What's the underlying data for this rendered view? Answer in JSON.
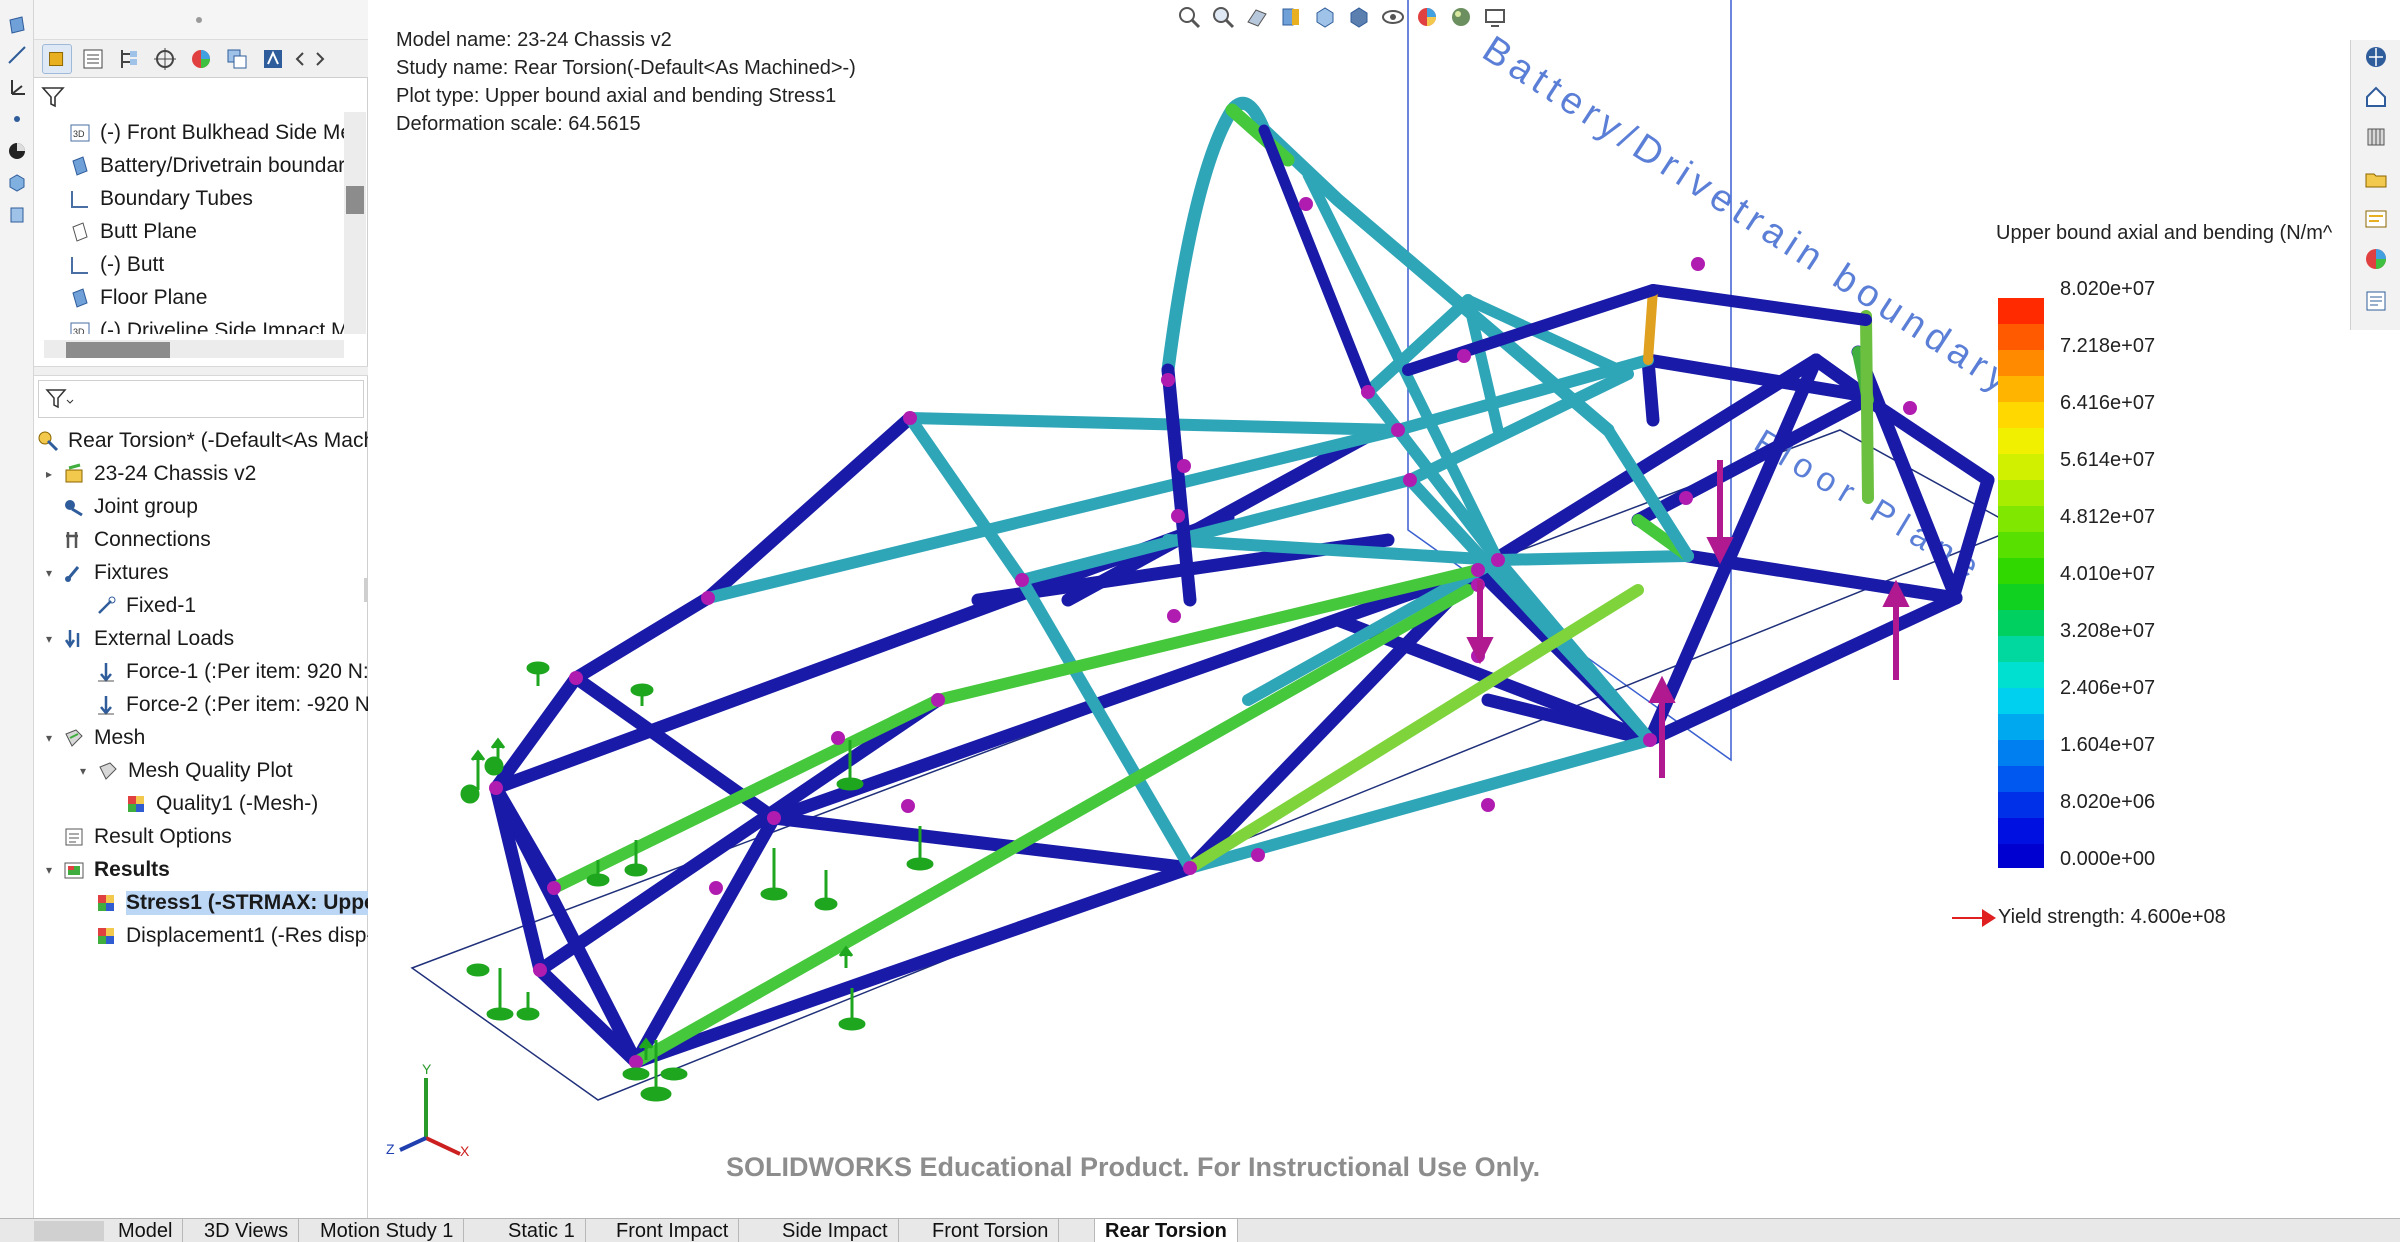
{
  "feature_tree": {
    "items": [
      {
        "label": "(-) Front Bulkhead Side Me",
        "icon": "3d-sketch-icon"
      },
      {
        "label": "Battery/Drivetrain boundar",
        "icon": "plane-icon"
      },
      {
        "label": "Boundary Tubes",
        "icon": "sketch-icon"
      },
      {
        "label": "Butt Plane",
        "icon": "plane-icon"
      },
      {
        "label": "(-) Butt",
        "icon": "sketch-icon"
      },
      {
        "label": "Floor Plane",
        "icon": "plane-icon"
      },
      {
        "label": "(-) Driveline Side Impact M",
        "icon": "3d-sketch-icon"
      }
    ]
  },
  "simulation_tree": {
    "root": "Rear Torsion* (-Default<As Mach",
    "items": [
      {
        "label": "23-24 Chassis v2",
        "icon": "part-icon"
      },
      {
        "label": "Joint group",
        "icon": "joint-group-icon"
      },
      {
        "label": "Connections",
        "icon": "connections-icon"
      },
      {
        "label": "Fixtures",
        "icon": "fixtures-icon"
      },
      {
        "label": "Fixed-1",
        "icon": "fixed-icon"
      },
      {
        "label": "External Loads",
        "icon": "external-loads-icon"
      },
      {
        "label": "Force-1 (:Per item: 920 N:)",
        "icon": "force-icon"
      },
      {
        "label": "Force-2 (:Per item: -920 N:",
        "icon": "force-icon"
      },
      {
        "label": "Mesh",
        "icon": "mesh-icon"
      },
      {
        "label": "Mesh Quality Plot",
        "icon": "mesh-quality-icon"
      },
      {
        "label": "Quality1 (-Mesh-)",
        "icon": "plot-icon"
      },
      {
        "label": "Result Options",
        "icon": "result-options-icon"
      },
      {
        "label": "Results",
        "icon": "results-icon"
      },
      {
        "label": "Stress1 (-STRMAX: Uppe",
        "icon": "plot-icon"
      },
      {
        "label": "Displacement1 (-Res disp-",
        "icon": "plot-icon"
      }
    ]
  },
  "plot_info": {
    "model_name": "Model name: 23-24 Chassis v2",
    "study_name": "Study name: Rear Torsion(-Default<As Machined>-)",
    "plot_type": "Plot type: Upper bound axial and bending Stress1",
    "deformation_scale": "Deformation scale: 64.5615"
  },
  "legend": {
    "title": "Upper bound axial and bending (N/m^",
    "values": [
      "8.020e+07",
      "7.218e+07",
      "6.416e+07",
      "5.614e+07",
      "4.812e+07",
      "4.010e+07",
      "3.208e+07",
      "2.406e+07",
      "1.604e+07",
      "8.020e+06",
      "0.000e+00"
    ],
    "yield_strength": "Yield strength: 4.600e+08"
  },
  "viewport_labels": {
    "boundary_plane": "Battery/Drivetrain boundary",
    "floor_plane": "Floor Plane"
  },
  "axes": {
    "y": "Y",
    "x": "X",
    "z": "Z"
  },
  "watermark": "SOLIDWORKS Educational Product. For Instructional Use Only.",
  "bottom_tabs": [
    {
      "label": "Model",
      "active": false
    },
    {
      "label": "3D Views",
      "active": false
    },
    {
      "label": "Motion Study 1",
      "active": false
    },
    {
      "label": "Static 1",
      "active": false
    },
    {
      "label": "Front Impact",
      "active": false
    },
    {
      "label": "Side Impact",
      "active": false
    },
    {
      "label": "Front Torsion",
      "active": false
    },
    {
      "label": "Rear Torsion",
      "active": true
    }
  ],
  "colors": {
    "tube_low": "#1a1aa8",
    "tube_mid": "#2ea6b8",
    "tube_high": "#46c83c",
    "node": "#b01cb0",
    "fixture": "#1fa61f",
    "load_arrow": "#b0198f",
    "plane_outline": "#3a5fd0",
    "selection": "#bcd6f5"
  }
}
